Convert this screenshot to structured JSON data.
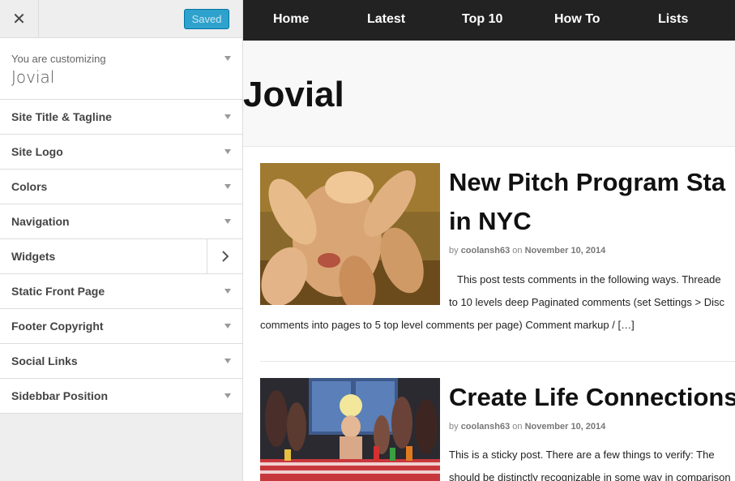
{
  "sidebar": {
    "close_label": "✕",
    "saved_label": "Saved",
    "customizing_label": "You are customizing",
    "theme_name": "Jovial",
    "sections": [
      {
        "label": "Site Title & Tagline"
      },
      {
        "label": "Site Logo"
      },
      {
        "label": "Colors"
      },
      {
        "label": "Navigation"
      },
      {
        "label": "Widgets"
      },
      {
        "label": "Static Front Page"
      },
      {
        "label": "Footer Copyright"
      },
      {
        "label": "Social Links"
      },
      {
        "label": "Sidebbar Position"
      }
    ]
  },
  "preview": {
    "nav": [
      "Home",
      "Latest",
      "Top 10",
      "How To",
      "Lists"
    ],
    "site_title": "Jovial",
    "posts": [
      {
        "title_line1": "New Pitch Program Sta",
        "title_line2": "in NYC",
        "meta_by": "by",
        "author": "coolansh63",
        "meta_on": "on",
        "date": "November 10, 2014",
        "excerpt_line1": "This post tests comments in the following ways. Threade",
        "excerpt_line2": "to 10 levels deep Paginated comments (set Settings > Disc",
        "excerpt_line3": "comments into pages to 5 top level comments per page) Comment markup / […]"
      },
      {
        "title_line1": "Create Life Connections",
        "meta_by": "by",
        "author": "coolansh63",
        "meta_on": "on",
        "date": "November 10, 2014",
        "excerpt_line1": "This is a sticky post. There are a few things to verify: The",
        "excerpt_line2": "should be distinctly recognizable in some way in comparison"
      }
    ]
  },
  "colors": {
    "nav_bg": "#222222",
    "saved_button": "#2ea2cc"
  }
}
